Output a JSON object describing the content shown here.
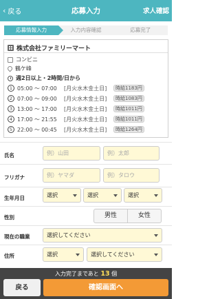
{
  "header": {
    "back_label": "戻る",
    "title": "応募入力",
    "job_confirm": "求人確認"
  },
  "steps": [
    "応募情報入力",
    "入力内容確認",
    "応募完了"
  ],
  "job": {
    "company": "株式会社ファミリーマート",
    "category": "コンビニ",
    "location": "鶴ケ峰",
    "schedule": "週2日以上・2時間/日から",
    "shifts": [
      {
        "num": "1",
        "time": "05:00 ～ 07:00",
        "days": "[月火水木金土日]",
        "pay": "時給1183円"
      },
      {
        "num": "2",
        "time": "07:00 ～ 09:00",
        "days": "[月火水木金土日]",
        "pay": "時給1083円"
      },
      {
        "num": "3",
        "time": "13:00 ～ 17:00",
        "days": "[月火水木金土日]",
        "pay": "時給1011円"
      },
      {
        "num": "4",
        "time": "17:00 ～ 21:55",
        "days": "[月火水木金土日]",
        "pay": "時給1011円"
      },
      {
        "num": "5",
        "time": "22:00 ～ 00:45",
        "days": "[月火水木金土日]",
        "pay": "時給1264円"
      }
    ]
  },
  "form": {
    "name_label": "氏名",
    "last_name_placeholder": "例）山田",
    "first_name_placeholder": "例）太郎",
    "kana_label": "フリガナ",
    "last_kana_placeholder": "例）ヤマダ",
    "first_kana_placeholder": "例）タロウ",
    "birth_label": "生年月日",
    "select_label": "選択",
    "gender_label": "性別",
    "male": "男性",
    "female": "女性",
    "job_label": "現在の職業",
    "select_please": "選択してください",
    "address_label": "住所"
  },
  "footer": {
    "remain_prefix": "入力完了まであと",
    "remain_count": "13",
    "remain_suffix": "個",
    "back_button": "戻る",
    "confirm_button": "確認画面へ"
  },
  "colors": {
    "accent": "#4db6c0",
    "cta": "#f39a36",
    "field_bg": "#fff9d6"
  }
}
